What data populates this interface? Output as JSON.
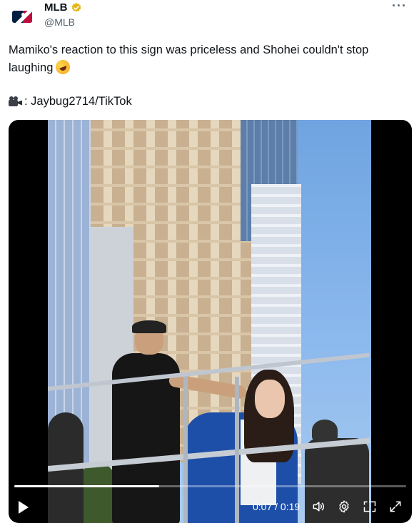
{
  "post": {
    "author_name": "MLB",
    "author_handle": "@MLB",
    "more_label": "···",
    "text_line1": "Mamiko's reaction to this sign was priceless and Shohei couldn't stop",
    "text_line2": "laughing",
    "text_emoji": "rolling-on-floor-laughing",
    "credit_text": ": Jaybug2714/TikTok",
    "credit_icon": "video-camera-icon"
  },
  "video": {
    "time_current": "0:07",
    "time_total": "0:19",
    "time_display": "0:07 / 0:19",
    "progress_fraction": 0.37,
    "controls": [
      "play",
      "volume",
      "settings",
      "picture-in-picture",
      "fullscreen"
    ]
  },
  "colors": {
    "verified_badge": "#e2b719",
    "text_primary": "#0f1419",
    "text_secondary": "#536471",
    "video_bg": "#000000"
  }
}
